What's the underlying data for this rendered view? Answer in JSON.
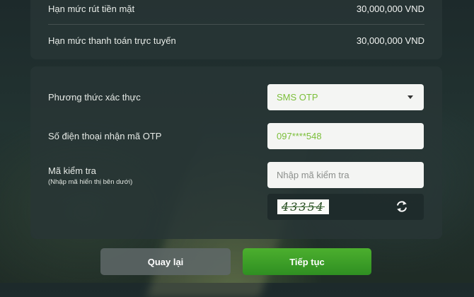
{
  "limits": [
    {
      "label": "Hạn mức rút tiền mặt",
      "value": "30,000,000 VND"
    },
    {
      "label": "Hạn mức thanh toán trực tuyến",
      "value": "30,000,000 VND"
    }
  ],
  "form": {
    "auth_method_label": "Phương thức xác thực",
    "auth_method_value": "SMS OTP",
    "phone_label": "Số điện thoại nhận mã OTP",
    "phone_value": "097****548",
    "captcha_label": "Mã kiểm tra",
    "captcha_hint": "(Nhập mã hiển thị bên dưới)",
    "captcha_placeholder": "Nhập mã kiểm tra",
    "captcha_text": "43354"
  },
  "buttons": {
    "back": "Quay lại",
    "next": "Tiếp tục"
  },
  "colors": {
    "accent": "#7bbf3a",
    "primary_button": "#3a9e28"
  },
  "icons": {
    "dropdown": "chevron-down-icon",
    "refresh": "refresh-icon"
  }
}
